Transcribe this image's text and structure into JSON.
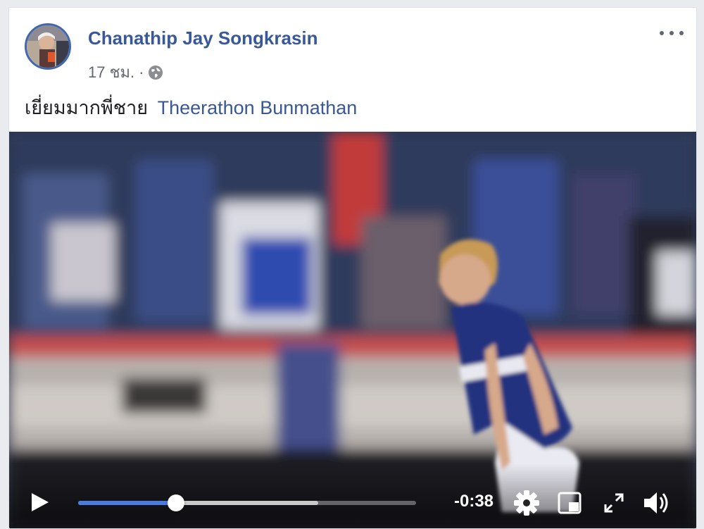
{
  "post": {
    "author": "Chanathip Jay Songkrasin",
    "time": "17 ชม.",
    "separator": "·",
    "privacy_icon": "globe-icon",
    "text": "เยี่ยมมากพี่ชาย",
    "mention": "Theerathon Bunmathan"
  },
  "video": {
    "remaining_time": "-0:38",
    "progress_fraction": 0.29,
    "buffered_fraction": 0.71,
    "icons": [
      "play-icon",
      "gear-icon",
      "picture-in-picture-icon",
      "fullscreen-icon",
      "volume-icon"
    ]
  },
  "colors": {
    "accent": "#385898",
    "progress": "#4a7be0",
    "page_bg": "#e9ebee"
  }
}
